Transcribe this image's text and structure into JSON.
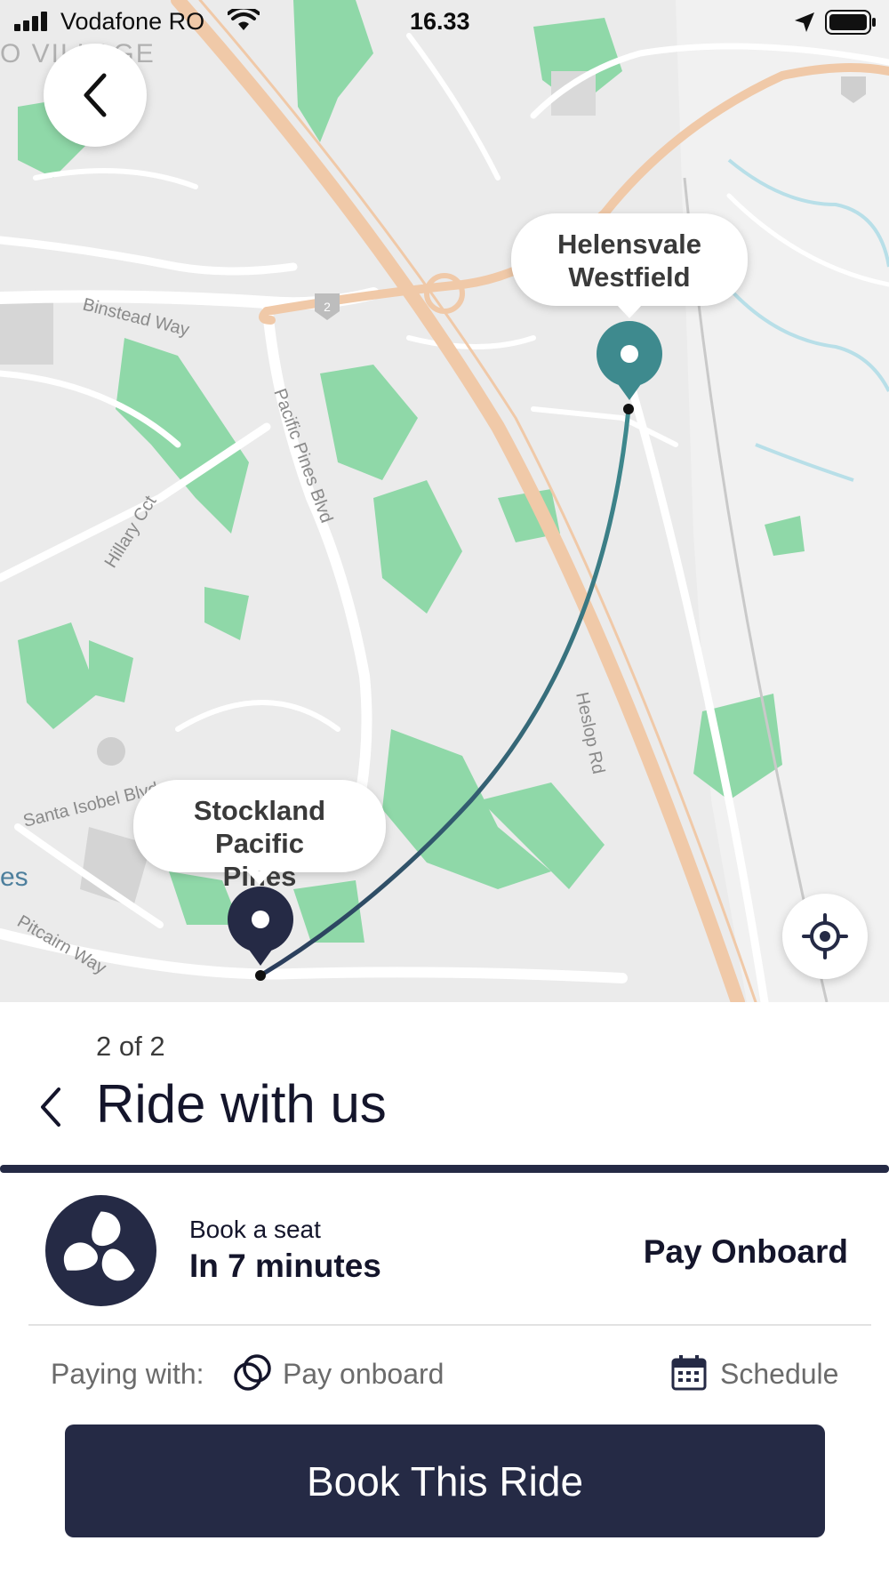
{
  "status_bar": {
    "carrier": "Vodafone RO",
    "time": "16.33"
  },
  "map": {
    "street_labels": [
      "Binstead Way",
      "Pacific Pines Blvd",
      "Hillary Cct",
      "Santa Isobel Blvd",
      "Heslop Rd",
      "Pitcairn Way"
    ],
    "area_labels": [
      "O VILLAGE",
      "es"
    ],
    "route_badge": "2",
    "destination_name": "Helensvale Westfield",
    "origin_name": "Stockland Pacific Pines",
    "colors": {
      "destination_pin": "#3e8a8e",
      "origin_pin": "#252a45",
      "route_line_start": "#2a3b5a",
      "route_line_end": "#3e8a8e",
      "park": "#8fd8a8",
      "motorway": "#f0c9a8"
    }
  },
  "panel": {
    "step": "2 of 2",
    "title": "Ride with us",
    "book_label": "Book a seat",
    "book_time": "In 7 minutes",
    "payment_method": "Pay Onboard",
    "paying_label": "Paying with:",
    "paying_value": "Pay onboard",
    "schedule_label": "Schedule",
    "book_button": "Book This Ride"
  },
  "icons": [
    "back-arrow-icon",
    "locate-icon",
    "map-pin-icon",
    "calendar-icon",
    "pay-onboard-icon",
    "service-logo-icon",
    "signal-icon",
    "wifi-icon",
    "location-arrow-icon",
    "battery-icon",
    "chevron-left-icon"
  ],
  "theme": {
    "primary": "#252a45",
    "accent": "#3e8a8e"
  }
}
